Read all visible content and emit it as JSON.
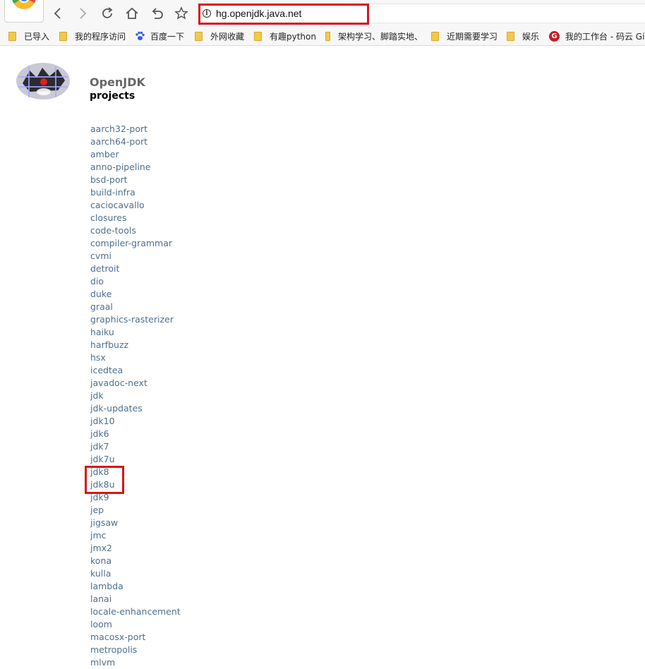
{
  "browser": {
    "url": "hg.openjdk.java.net",
    "bookmarks": [
      {
        "label": "已导入",
        "icon": "folder-icon"
      },
      {
        "label": "我的程序访问",
        "icon": "folder-icon"
      },
      {
        "label": "百度一下",
        "icon": "baidu-paw-icon"
      },
      {
        "label": "外网收藏",
        "icon": "folder-icon"
      },
      {
        "label": "有趣python",
        "icon": "folder-icon"
      },
      {
        "label": "架构学习、脚踏实地、",
        "icon": "folder-icon"
      },
      {
        "label": "近期需要学习",
        "icon": "folder-icon"
      },
      {
        "label": "娱乐",
        "icon": "folder-icon"
      },
      {
        "label": "我的工作台 - 码云 Gi",
        "icon": "gitee-icon"
      }
    ]
  },
  "page": {
    "title": "OpenJDK",
    "subtitle": "projects",
    "projects": [
      "aarch32-port",
      "aarch64-port",
      "amber",
      "anno-pipeline",
      "bsd-port",
      "build-infra",
      "caciocavallo",
      "closures",
      "code-tools",
      "compiler-grammar",
      "cvmi",
      "detroit",
      "dio",
      "duke",
      "graal",
      "graphics-rasterizer",
      "haiku",
      "harfbuzz",
      "hsx",
      "icedtea",
      "javadoc-next",
      "jdk",
      "jdk-updates",
      "jdk10",
      "jdk6",
      "jdk7",
      "jdk7u",
      "jdk8",
      "jdk8u",
      "jdk9",
      "jep",
      "jigsaw",
      "jmc",
      "jmx2",
      "kona",
      "kulla",
      "lambda",
      "lanai",
      "locale-enhancement",
      "loom",
      "macosx-port",
      "metropolis",
      "mlvm"
    ]
  },
  "colors": {
    "link": "#4e6f8f",
    "highlight": "#d6151b"
  }
}
